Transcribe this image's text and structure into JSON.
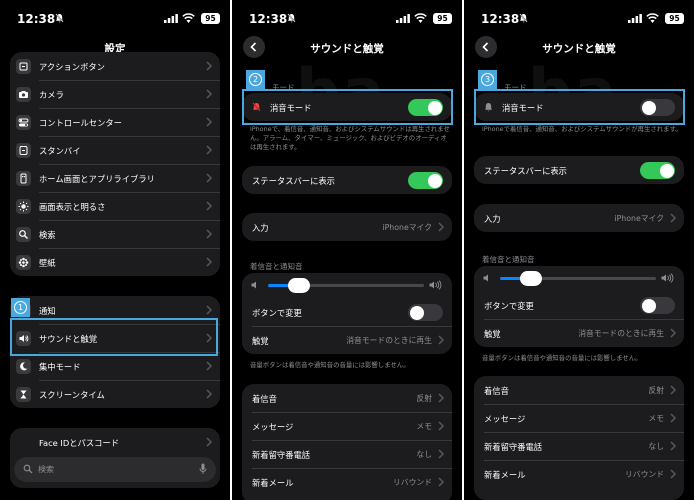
{
  "status_bar": {
    "time": "12:38",
    "battery": "95"
  },
  "panel1": {
    "title": "設定",
    "group1": [
      {
        "label": "アクションボタン",
        "icon": "action-button-icon"
      },
      {
        "label": "カメラ",
        "icon": "camera-icon"
      },
      {
        "label": "コントロールセンター",
        "icon": "control-center-icon"
      },
      {
        "label": "スタンバイ",
        "icon": "standby-icon"
      },
      {
        "label": "ホーム画面とアプリライブラリ",
        "icon": "home-screen-icon"
      },
      {
        "label": "画面表示と明るさ",
        "icon": "brightness-icon"
      },
      {
        "label": "検索",
        "icon": "search-icon"
      },
      {
        "label": "壁紙",
        "icon": "wallpaper-icon"
      }
    ],
    "group2": [
      {
        "label": "通知",
        "icon": "notifications-icon"
      },
      {
        "label": "サウンドと触覚",
        "icon": "sounds-icon"
      },
      {
        "label": "集中モード",
        "icon": "focus-moon-icon"
      },
      {
        "label": "スクリーンタイム",
        "icon": "hourglass-icon"
      }
    ],
    "group3": [
      {
        "label": "Face IDとパスコード",
        "icon": "face-id-icon"
      }
    ],
    "search_placeholder": "検索",
    "step_badge": "1"
  },
  "panel2": {
    "title": "サウンドと触覚",
    "step_badge": "2",
    "mode_label": "モード",
    "silent_mode": {
      "label": "消音モード",
      "on": true
    },
    "silent_note": "iPhoneで、着信音、通知音、およびシステムサウンドは再生されません。アラーム、タイマー、ミュージック、およびビデオのオーディオは再生されます。",
    "status_bar_row": {
      "label": "ステータスバーに表示",
      "on": true
    },
    "input_row": {
      "label": "入力",
      "value": "iPhoneマイク"
    },
    "ringtone_header": "着信音と通知音",
    "volume": 0.2,
    "button_change": {
      "label": "ボタンで変更",
      "on": false
    },
    "haptics": {
      "label": "触覚",
      "value": "消音モードのときに再生"
    },
    "volume_note": "音量ボタンは着信音や通知音の音量には影響しません。",
    "sounds": [
      {
        "label": "着信音",
        "value": "反射"
      },
      {
        "label": "メッセージ",
        "value": "メモ"
      },
      {
        "label": "新着留守番電話",
        "value": "なし"
      },
      {
        "label": "新着メール",
        "value": "リバウンド"
      }
    ]
  },
  "panel3": {
    "title": "サウンドと触覚",
    "step_badge": "3",
    "mode_label": "モード",
    "silent_mode": {
      "label": "消音モード",
      "on": false
    },
    "silent_note": "iPhoneで着信音、通知音、およびシステムサウンドが再生されます。",
    "status_bar_row": {
      "label": "ステータスバーに表示",
      "on": true
    },
    "input_row": {
      "label": "入力",
      "value": "iPhoneマイク"
    },
    "ringtone_header": "着信音と通知音",
    "volume": 0.2,
    "button_change": {
      "label": "ボタンで変更",
      "on": false
    },
    "haptics": {
      "label": "触覚",
      "value": "消音モードのときに再生"
    },
    "volume_note": "音量ボタンは着信音や通知音の音量には影響しません。",
    "sounds": [
      {
        "label": "着信音",
        "value": "反射"
      },
      {
        "label": "メッセージ",
        "value": "メモ"
      },
      {
        "label": "新着留守番電話",
        "value": "なし"
      },
      {
        "label": "新着メール",
        "value": "リバウンド"
      }
    ]
  },
  "colors": {
    "highlight": "#4aa8e0",
    "toggle_on": "#34c759",
    "slider_fill": "#0a84ff",
    "background": "#000000",
    "group_bg": "#1c1c1e"
  }
}
